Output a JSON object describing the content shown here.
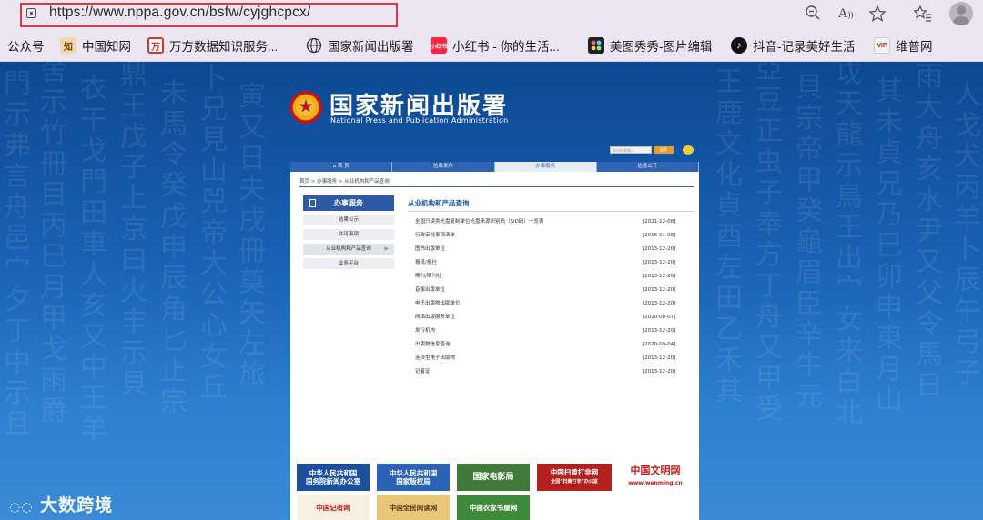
{
  "browser": {
    "url": "https://www.nppa.gov.cn/bsfw/cyjghcpcx/",
    "bookmarks": [
      {
        "label": "公众号",
        "icon": "none"
      },
      {
        "label": "中国知网",
        "icon": "cnki-icon",
        "color": "#f2d9a8"
      },
      {
        "label": "万方数据知识服务...",
        "icon": "wanfang-icon",
        "color": "#d8352a"
      },
      {
        "label": "国家新闻出版署",
        "icon": "globe-icon",
        "color": "#333333"
      },
      {
        "label": "小红书 - 你的生活...",
        "icon": "xiaohongshu-icon",
        "color": "#ff2442"
      },
      {
        "label": "美图秀秀-图片编辑",
        "icon": "meitu-icon",
        "color": "#222222"
      },
      {
        "label": "抖音-记录美好生活",
        "icon": "douyin-icon",
        "color": "#111111"
      },
      {
        "label": "维普网",
        "icon": "vip-icon",
        "color": "#f4f4f4"
      }
    ],
    "toolbar_icons": [
      "zoom-out-icon",
      "read-aloud-icon",
      "favorite-star-icon",
      "favorites-list-icon",
      "profile-avatar-icon"
    ]
  },
  "site": {
    "name": "国家新闻出版署",
    "name_en": "National Press and Publication Administration",
    "search_placeholder": "站内检索输入",
    "search_button": "搜索"
  },
  "nav": [
    {
      "label": "首 页",
      "active": false
    },
    {
      "label": "信息发布",
      "active": false
    },
    {
      "label": "办事服务",
      "active": true
    },
    {
      "label": "信息公开",
      "active": false
    }
  ],
  "breadcrumb": "首页 > 办事服务 > 从业机构和产品查询",
  "sidebar": {
    "title": "办事服务",
    "items": [
      {
        "label": "结果公示",
        "active": false
      },
      {
        "label": "许可事项",
        "active": false
      },
      {
        "label": "从业机构和产品查询",
        "active": true
      },
      {
        "label": "业务平台",
        "active": false
      }
    ]
  },
  "main": {
    "title": "从业机构和产品查询",
    "rows": [
      {
        "title": "全国只读类光盘复制单位光盘来源识别码（SID码）一览表",
        "date": "[2021-12-08]"
      },
      {
        "title": "行政审批事项清单",
        "date": "[2016-01-08]"
      },
      {
        "title": "图书出版单位",
        "date": "[2013-12-20]"
      },
      {
        "title": "报纸/报社",
        "date": "[2013-12-20]"
      },
      {
        "title": "期刊/期刊社",
        "date": "[2013-12-20]"
      },
      {
        "title": "音像出版单位",
        "date": "[2013-12-20]"
      },
      {
        "title": "电子出版物出版单位",
        "date": "[2013-12-20]"
      },
      {
        "title": "网络出版服务单位",
        "date": "[2020-08-07]"
      },
      {
        "title": "发行机构",
        "date": "[2013-12-20]"
      },
      {
        "title": "出版物信息查询",
        "date": "[2020-09-04]"
      },
      {
        "title": "连续型电子出版物",
        "date": "[2013-12-20]"
      },
      {
        "title": "记者证",
        "date": "[2013-12-20]"
      }
    ]
  },
  "banners": [
    {
      "line1": "中华人民共和国",
      "line2": "国务院新闻办公室",
      "bg": "#1d4f9f",
      "color": "#ffffff"
    },
    {
      "line1": "中华人民共和国",
      "line2": "国家版权局",
      "bg": "#2a63b5",
      "color": "#ffffff"
    },
    {
      "line1": "国家电影局",
      "line2": "",
      "bg": "#3f7a3a",
      "color": "#ffffff"
    },
    {
      "line1": "中国扫黄打非网",
      "line2": "全国“扫黄打非”办公室",
      "bg": "#b3201d",
      "color": "#ffffff"
    },
    {
      "line1": "中国文明网",
      "line2": "www.wenming.cn",
      "bg": "#ffffff",
      "color": "#c91a1a"
    },
    {
      "line1": "中国记者网",
      "line2": "",
      "bg": "#f6efe2",
      "color": "#b3201d"
    },
    {
      "line1": "中国全民阅读网",
      "line2": "",
      "bg": "#e9c67a",
      "color": "#5a3b0d"
    },
    {
      "line1": "中国农家书屋网",
      "line2": "",
      "bg": "#3d8a3a",
      "color": "#ffffff"
    }
  ],
  "watermark": "大数跨境"
}
